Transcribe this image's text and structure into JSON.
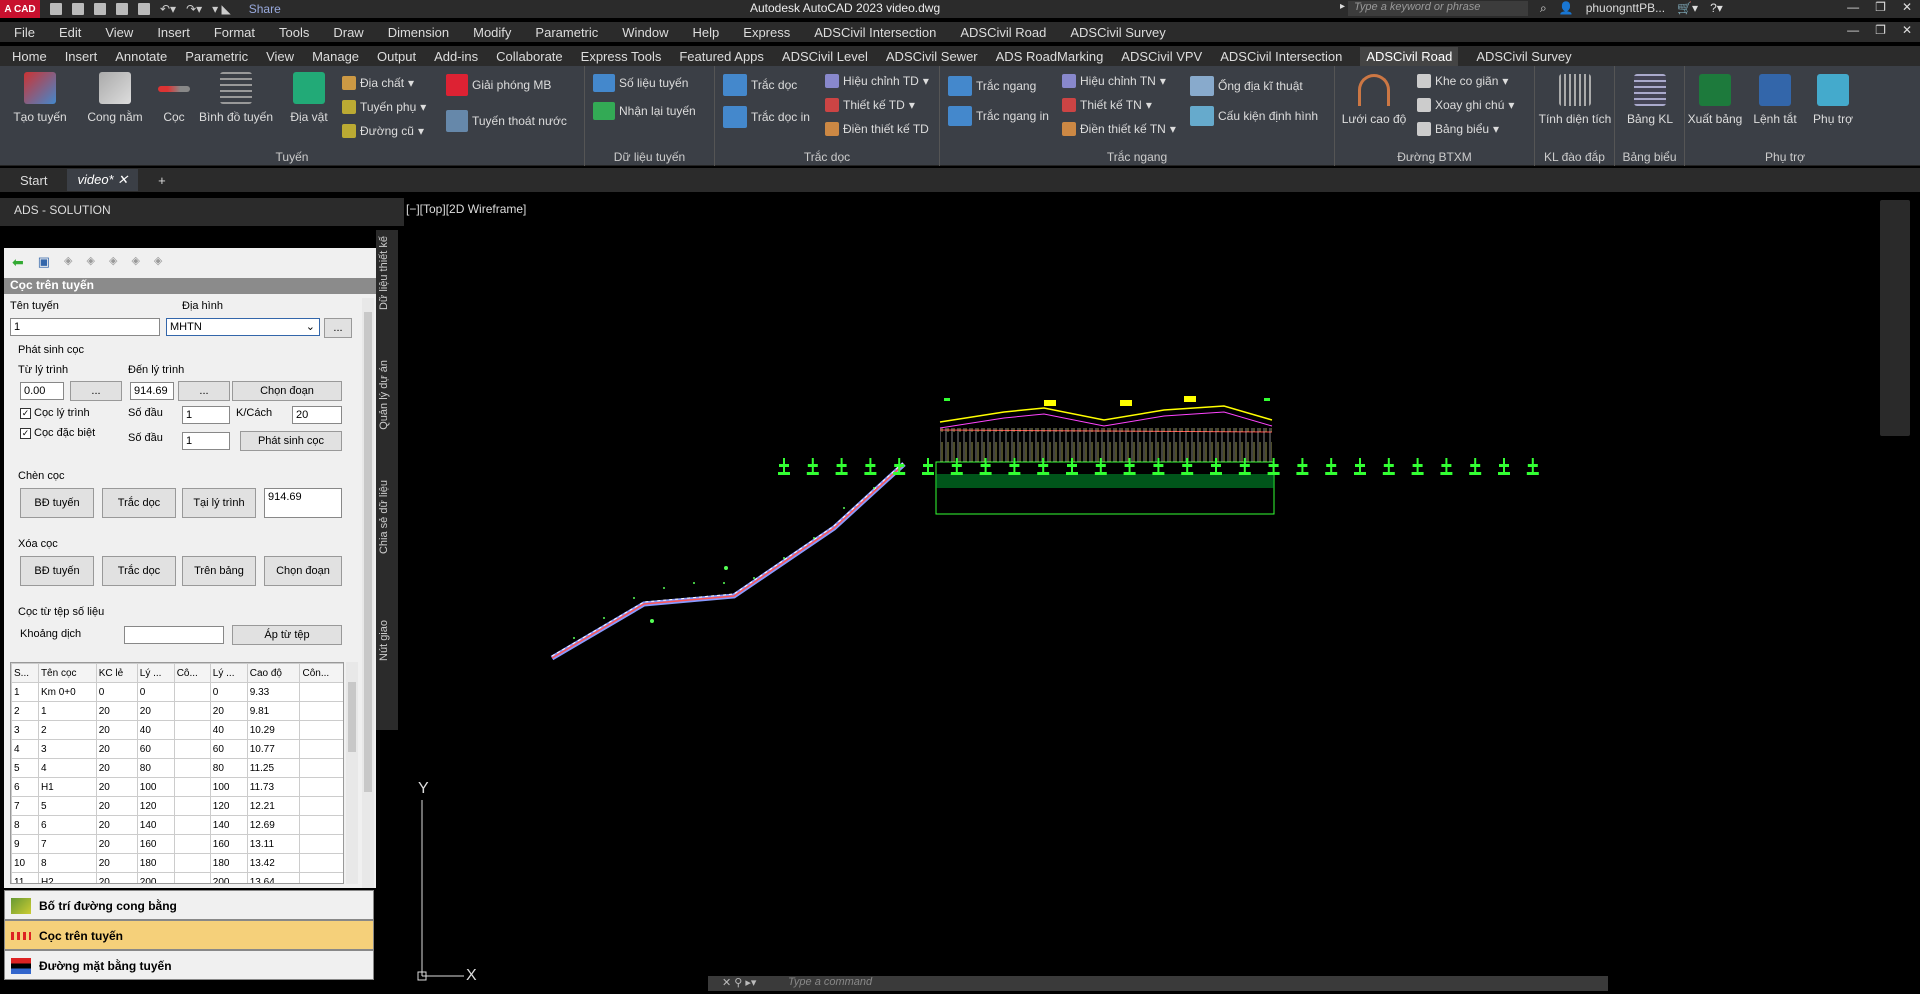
{
  "titlebar": {
    "app_logo": "A CAD",
    "share": "Share",
    "title": "Autodesk AutoCAD 2023    video.dwg",
    "search_placeholder": "Type a keyword or phrase",
    "user": "phuongnttPB...",
    "icons": [
      "new-icon",
      "open-icon",
      "save-icon",
      "saveas-icon",
      "print-icon",
      "undo-icon",
      "redo-icon",
      "share-icon",
      "search-icon",
      "user-icon",
      "cart-icon",
      "help-icon",
      "minimize-icon",
      "restore-icon",
      "close-icon"
    ]
  },
  "menubar": [
    "File",
    "Edit",
    "View",
    "Insert",
    "Format",
    "Tools",
    "Draw",
    "Dimension",
    "Modify",
    "Parametric",
    "Window",
    "Help",
    "Express",
    "ADSCivil Intersection",
    "ADSCivil Road",
    "ADSCivil Survey"
  ],
  "ribbon_tabs": [
    "Home",
    "Insert",
    "Annotate",
    "Parametric",
    "View",
    "Manage",
    "Output",
    "Add-ins",
    "Collaborate",
    "Express Tools",
    "Featured Apps",
    "ADSCivil Level",
    "ADSCivil Sewer",
    "ADS RoadMarking",
    "ADSCivil VPV",
    "ADSCivil Intersection",
    "ADSCivil Road",
    "ADSCivil Survey"
  ],
  "ribbon_active_tab": "ADSCivil Road",
  "ribbon": {
    "tuyen": {
      "label": "Tuyến",
      "tao_tuyen": "Tạo tuyến",
      "cong_nam": "Cong nằm",
      "coc": "Cọc",
      "binh_do_tuyen": "Bình đồ tuyến",
      "dia_vat": "Địa vật",
      "dia_chat": "Địa chất",
      "tuyen_phu": "Tuyến phụ",
      "duong_cu": "Đường cũ",
      "giai_phong_mb": "Giải phóng MB",
      "tuyen_thoat_nuoc": "Tuyến thoát nước"
    },
    "du_lieu_tuyen": {
      "label": "Dữ liệu tuyến",
      "so_lieu_tuyen": "Số liệu tuyến",
      "nhan_lai_tuyen": "Nhận lại tuyến"
    },
    "trac_doc": {
      "label": "Trắc dọc",
      "trac_doc": "Trắc dọc",
      "trac_doc_in": "Trắc dọc in",
      "hieu_chinh_td": "Hiệu chỉnh TD",
      "thiet_ke_td": "Thiết kế TD",
      "dien_thiet_ke_td": "Điền thiết kế TD"
    },
    "trac_ngang": {
      "label": "Trắc ngang",
      "trac_ngang": "Trắc ngang",
      "trac_ngang_in": "Trắc ngang in",
      "hieu_chinh_tn": "Hiệu chỉnh TN",
      "thiet_ke_tn": "Thiết kế TN",
      "dien_thiet_ke_tn": "Điền thiết kế TN",
      "ong_dia_ki_thuat": "Ống địa kĩ thuật",
      "cau_kien_dinh_hinh": "Cấu kiện định hình"
    },
    "duong_btxm": {
      "label": "Đường BTXM",
      "luoi_cao_do": "Lưới cao độ",
      "khe_co_gian": "Khe co giãn",
      "xoay_ghi_chu": "Xoay ghi chú",
      "bang_bieu": "Bảng biểu"
    },
    "kl_dao_dap": {
      "label": "KL đào đắp",
      "tinh_dien_tich": "Tính diện tích"
    },
    "bang_bieu": {
      "label": "Bảng biểu",
      "bang_kl": "Bảng KL"
    },
    "phu_tro": {
      "label": "Phụ trợ",
      "xuat_bang": "Xuất bảng",
      "lenh_tat": "Lệnh tắt",
      "phu_tro": "Phụ trợ"
    }
  },
  "doc_tabs": [
    "Start",
    "video*"
  ],
  "viewport_label": "[−][Top][2D Wireframe]",
  "panel": {
    "title": "ADS - SOLUTION",
    "side_tabs": [
      "Dữ liệu thiết kế",
      "Quản lý dự án",
      "Chia sẻ dữ liệu",
      "Nút giao"
    ],
    "header": "Cọc trên tuyến",
    "ten_tuyen_label": "Tên tuyến",
    "ten_tuyen_value": "1",
    "dia_hinh_label": "Địa hình",
    "dia_hinh_value": "MHTN",
    "dots": "...",
    "phat_sinh_coc": "Phát sinh cọc",
    "tu_ly_trinh": "Từ lý trình",
    "tu_ly_trinh_value": "0.00",
    "den_ly_trinh": "Đến lý trình",
    "den_ly_trinh_value": "914.69",
    "chon_doan": "Chọn đoạn",
    "coc_ly_trinh": "Cọc lý trình",
    "coc_dac_biet": "Cọc đặc biệt",
    "so_dau": "Số đầu",
    "so_dau_1": "1",
    "so_dau_2": "1",
    "k_cach": "K/Cách",
    "k_cach_value": "20",
    "phat_sinh_coc_btn": "Phát sinh cọc",
    "chen_coc": "Chèn cọc",
    "bd_tuyen": "BĐ tuyến",
    "trac_doc": "Trắc dọc",
    "tai_ly_trinh": "Tại lý trình",
    "tai_ly_trinh_value": "914.69",
    "xoa_coc": "Xóa cọc",
    "tren_bang": "Trên bảng",
    "coc_tu_tep": "Cọc từ tệp số liệu",
    "khoang_dich": "Khoảng dịch",
    "ap_tu_tep": "Áp từ tệp",
    "table": {
      "columns": [
        "S...",
        "Tên cọc",
        "KC lẻ",
        "Lý ...",
        "Cô...",
        "Lý ...",
        "Cao độ",
        "Côn..."
      ],
      "rows": [
        [
          "1",
          "Km 0+0",
          "0",
          "0",
          "",
          "0",
          "9.33",
          ""
        ],
        [
          "2",
          "1",
          "20",
          "20",
          "",
          "20",
          "9.81",
          ""
        ],
        [
          "3",
          "2",
          "20",
          "40",
          "",
          "40",
          "10.29",
          ""
        ],
        [
          "4",
          "3",
          "20",
          "60",
          "",
          "60",
          "10.77",
          ""
        ],
        [
          "5",
          "4",
          "20",
          "80",
          "",
          "80",
          "11.25",
          ""
        ],
        [
          "6",
          "H1",
          "20",
          "100",
          "",
          "100",
          "11.73",
          ""
        ],
        [
          "7",
          "5",
          "20",
          "120",
          "",
          "120",
          "12.21",
          ""
        ],
        [
          "8",
          "6",
          "20",
          "140",
          "",
          "140",
          "12.69",
          ""
        ],
        [
          "9",
          "7",
          "20",
          "160",
          "",
          "160",
          "13.11",
          ""
        ],
        [
          "10",
          "8",
          "20",
          "180",
          "",
          "180",
          "13.42",
          ""
        ],
        [
          "11",
          "H2",
          "20",
          "200",
          "",
          "200",
          "13.64",
          ""
        ]
      ]
    },
    "bottom_buttons": [
      "Bố trí đường cong bằng",
      "Cọc trên tuyến",
      "Đường mặt bằng tuyến"
    ]
  },
  "command_placeholder": "Type a command",
  "ucs": {
    "y": "Y",
    "x": "X"
  }
}
